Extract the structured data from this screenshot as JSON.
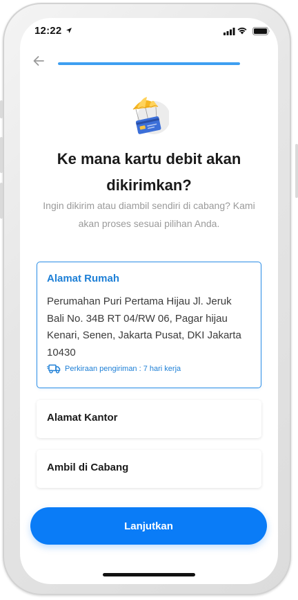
{
  "status_bar": {
    "time": "12:22"
  },
  "header": {
    "progress": 1.0
  },
  "page": {
    "title": "Ke mana kartu debit akan dikirimkan?",
    "subtitle": "Ingin dikirim atau diambil sendiri di cabang? Kami akan proses sesuai pilihan Anda."
  },
  "options": {
    "home": {
      "title": "Alamat Rumah",
      "address": "Perumahan Puri Pertama Hijau Jl. Jeruk Bali No. 34B RT 04/RW 06, Pagar hijau Kenari, Senen, Jakarta Pusat, DKI Jakarta 10430",
      "eta": "Perkiraan pengiriman : 7 hari kerja",
      "selected": true
    },
    "office": {
      "title": "Alamat Kantor"
    },
    "branch": {
      "title": "Ambil di Cabang"
    }
  },
  "cta": {
    "label": "Lanjutkan"
  },
  "colors": {
    "accent": "#0a7cf7",
    "selected_border": "#2e8fe6",
    "progress": "#3e9ff1"
  }
}
